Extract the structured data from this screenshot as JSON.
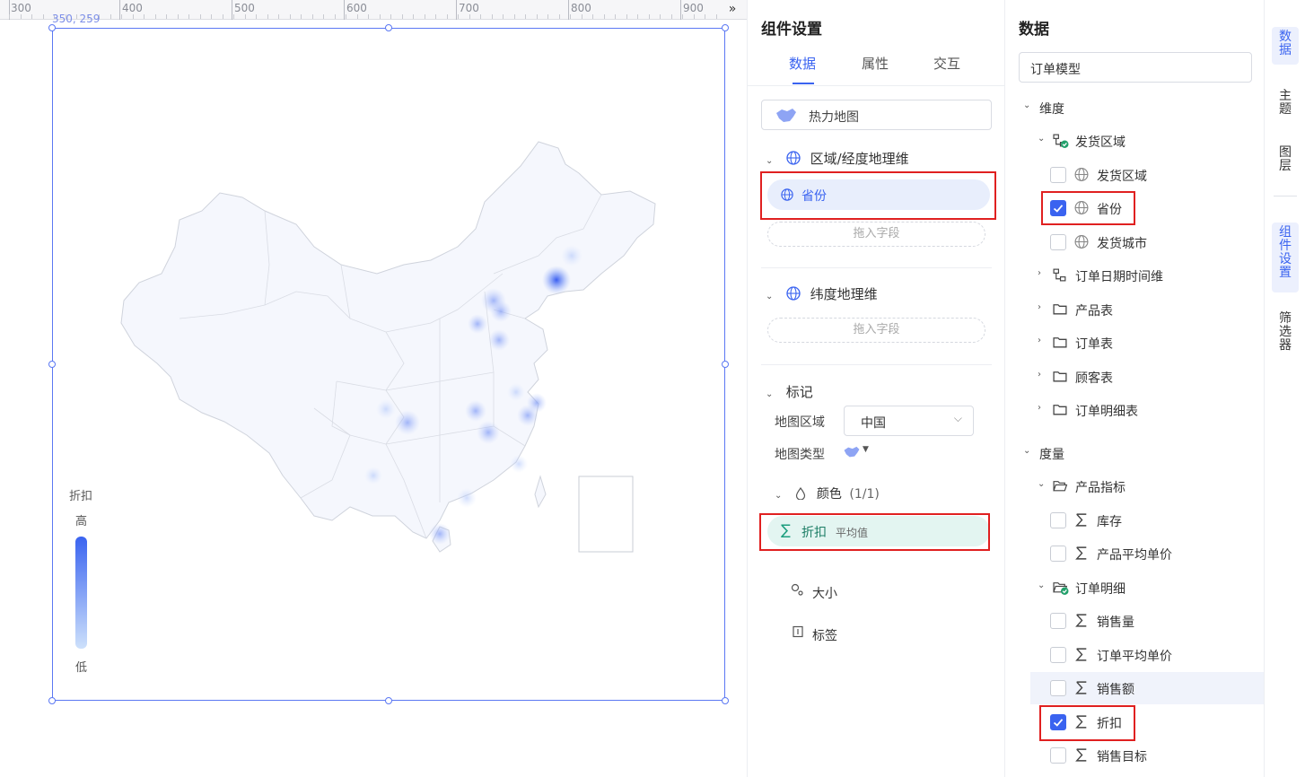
{
  "ruler": {
    "labels": [
      "300",
      "400",
      "500",
      "600",
      "700",
      "800",
      "900"
    ],
    "collapse": "»"
  },
  "canvas": {
    "coord": "350, 259",
    "legend": {
      "title": "折扣",
      "high": "高",
      "low": "低",
      "gradient": [
        "#3a63f0",
        "#cde0fb"
      ]
    }
  },
  "settings": {
    "title": "组件设置",
    "tabs": [
      {
        "label": "数据",
        "active": true
      },
      {
        "label": "属性"
      },
      {
        "label": "交互"
      }
    ],
    "chart_type": {
      "label": "热力地图",
      "icon": "china-map-icon"
    },
    "geo_section": {
      "title": "区域/经度地理维",
      "field": "省份",
      "drop": "拖入字段"
    },
    "lat_section": {
      "title": "纬度地理维",
      "drop": "拖入字段"
    },
    "marks": {
      "title": "标记",
      "map_region_label": "地图区域",
      "map_region_value": "中国",
      "map_type_label": "地图类型",
      "color_title": "颜色",
      "color_count": "(1/1)",
      "color_field": "折扣",
      "color_agg": "平均值",
      "size_label": "大小",
      "label_label": "标签"
    }
  },
  "data": {
    "title": "数据",
    "model": "订单模型",
    "dimensions_title": "维度",
    "dimensions": [
      {
        "label": "发货区域",
        "kind": "hierarchy",
        "expanded": true
      },
      {
        "label": "发货区域",
        "kind": "geo-field",
        "checked": false
      },
      {
        "label": "省份",
        "kind": "geo-field",
        "checked": true
      },
      {
        "label": "发货城市",
        "kind": "geo-field",
        "checked": false
      },
      {
        "label": "订单日期时间维",
        "kind": "hierarchy",
        "expanded": false
      },
      {
        "label": "产品表",
        "kind": "folder",
        "expanded": false
      },
      {
        "label": "订单表",
        "kind": "folder",
        "expanded": false
      },
      {
        "label": "顾客表",
        "kind": "folder",
        "expanded": false
      },
      {
        "label": "订单明细表",
        "kind": "folder",
        "expanded": false
      }
    ],
    "measures_title": "度量",
    "measures": [
      {
        "label": "产品指标",
        "kind": "folder",
        "expanded": true
      },
      {
        "label": "库存",
        "kind": "measure",
        "checked": false
      },
      {
        "label": "产品平均单价",
        "kind": "measure",
        "checked": false
      },
      {
        "label": "订单明细",
        "kind": "folder",
        "expanded": true
      },
      {
        "label": "销售量",
        "kind": "measure",
        "checked": false
      },
      {
        "label": "订单平均单价",
        "kind": "measure",
        "checked": false
      },
      {
        "label": "销售额",
        "kind": "measure",
        "checked": false
      },
      {
        "label": "折扣",
        "kind": "measure",
        "checked": true
      },
      {
        "label": "销售目标",
        "kind": "measure",
        "checked": false
      }
    ]
  },
  "rail": [
    {
      "label": "数据",
      "active": true
    },
    {
      "label": "主题"
    },
    {
      "label": "图层"
    },
    {
      "label": "组件设置",
      "active": true
    },
    {
      "label": "筛选器"
    }
  ],
  "colors": {
    "accent": "#3a63f0",
    "highlight": "#e02020",
    "pill_geo": "#e8eefc",
    "pill_measure": "#e3f5f1"
  }
}
